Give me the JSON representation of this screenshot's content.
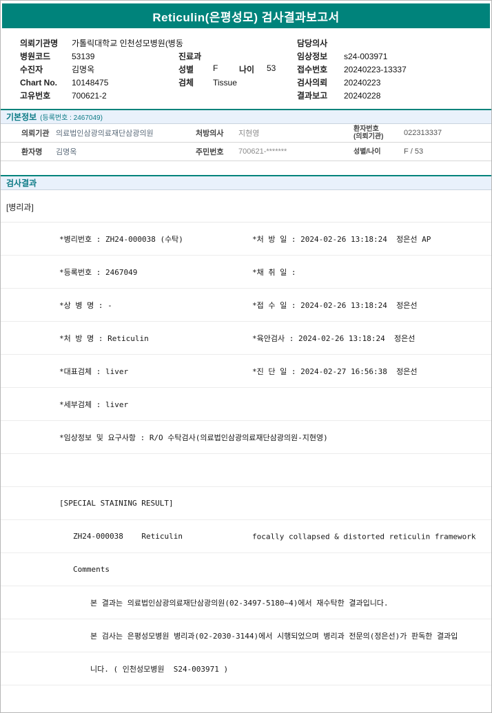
{
  "colors": {
    "header_teal": "#00837B",
    "section_bg": "#E9F1FB",
    "section_text": "#0B7A85"
  },
  "title": "Reticulin(은평성모) 검사결과보고서",
  "patient": {
    "rows": [
      {
        "l1": "의뢰기관명",
        "v1": "가톨릭대학교 인천성모병원(병동",
        "l2": "",
        "v2": "",
        "l2b": "",
        "v2b": "",
        "l3": "담당의사",
        "v3": ""
      },
      {
        "l1": "병원코드",
        "v1": "53139",
        "l2": "진료과",
        "v2": "",
        "l2b": "",
        "v2b": "",
        "l3": "임상정보",
        "v3": "s24-003971"
      },
      {
        "l1": "수진자",
        "v1": "김명옥",
        "l2": "성별",
        "v2": "F",
        "l2b": "나이",
        "v2b": "53",
        "l3": "접수번호",
        "v3": "20240223-13337"
      },
      {
        "l1": "Chart No.",
        "v1": "10148475",
        "l2": "검체",
        "v2": "Tissue",
        "l2b": "",
        "v2b": "",
        "l3": "검사의뢰",
        "v3": "20240223"
      },
      {
        "l1": "고유번호",
        "v1": "700621-2",
        "l2": "",
        "v2": "",
        "l2b": "",
        "v2b": "",
        "l3": "결과보고",
        "v3": "20240228"
      }
    ]
  },
  "basic_info": {
    "title": "기본정보",
    "subtitle": "(등록번호 : 2467049)",
    "rows": [
      {
        "l1": "의뢰기관",
        "v1": "의료법인삼광의료재단삼광의원",
        "l2": "처방의사",
        "v2": "지현영",
        "l3a": "환자번호",
        "l3b": "(의뢰기관)",
        "v3": "022313337"
      },
      {
        "l1": "환자명",
        "v1": "김명옥",
        "l2": "주민번호",
        "v2": "700621-*******",
        "l3a": "성별/나이",
        "l3b": "",
        "v3": "F / 53"
      }
    ]
  },
  "results": {
    "title": "검사결과",
    "dept": "[병리과]",
    "rows": [
      {
        "left": "*병리번호 : ZH24-000038 (수탁)",
        "right": "*처 방 일 : 2024-02-26 13:18:24  정은선 AP"
      },
      {
        "left": "*등록번호 : 2467049",
        "right": "*채 취 일 :"
      },
      {
        "left": "*상 병 명 : -",
        "right": "*접 수 일 : 2024-02-26 13:18:24  정은선"
      },
      {
        "left": "*처 방 명 : Reticulin",
        "right": "*육안검사 : 2024-02-26 13:18:24  정은선"
      },
      {
        "left": "*대표검체 : liver",
        "right": "*진 단 일 : 2024-02-27 16:56:38  정은선"
      },
      {
        "left": "*세부검체 : liver",
        "right": ""
      },
      {
        "left": "*임상정보 및 요구사항 : R/O 수탁검사(의료법인삼광의료재단삼광의원-지현영)",
        "right": ""
      },
      {
        "left": "",
        "right": ""
      },
      {
        "left": "[SPECIAL STAINING RESULT]",
        "right": ""
      },
      {
        "left": "ZH24-000038    Reticulin",
        "right": "focally collapsed & distorted reticulin framework"
      },
      {
        "left": "Comments",
        "right": ""
      },
      {
        "left": "본 결과는 의료법인삼광의료재단삼광의원(02-3497-5180~4)에서 재수탁한 결과입니다.",
        "right": ""
      },
      {
        "left": "본 검사는 은평성모병원 병리과(02-2030-3144)에서 시행되었으며 병리과 전문의(정은선)가 판독한 결과입",
        "right": ""
      },
      {
        "left": "니다. ( 인천성모병원  S24-003971 )",
        "right": ""
      }
    ]
  }
}
